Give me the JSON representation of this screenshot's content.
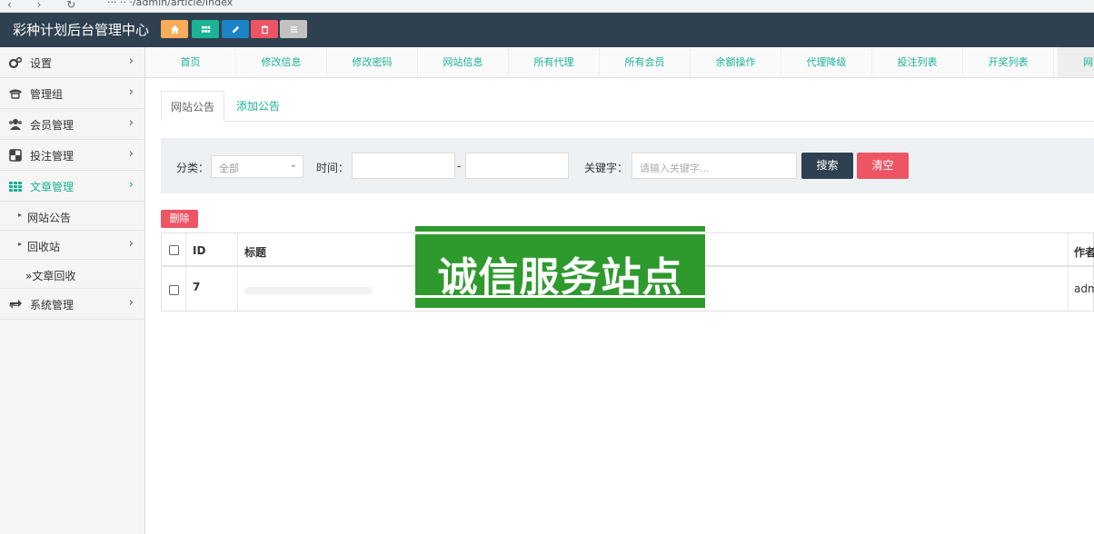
{
  "browser": {
    "nav_glyphs": "‹ › ↻",
    "url": "··· ·· ·/admin/article/index"
  },
  "header": {
    "brand": "彩种计划后台管理中心",
    "quick_buttons": [
      {
        "icon": "home-icon",
        "color": "#f8ac59"
      },
      {
        "icon": "grid-icon",
        "color": "#1ab394"
      },
      {
        "icon": "pencil-icon",
        "color": "#1c84c6"
      },
      {
        "icon": "trash-icon",
        "color": "#ed5565"
      },
      {
        "icon": "list-icon",
        "color": "#c2c2c2"
      }
    ]
  },
  "sidebar": {
    "items": [
      {
        "label": "设置",
        "icon": "gears-icon"
      },
      {
        "label": "管理组",
        "icon": "phone-icon"
      },
      {
        "label": "会员管理",
        "icon": "users-icon"
      },
      {
        "label": "投注管理",
        "icon": "dice-icon"
      },
      {
        "label": "文章管理",
        "icon": "table-grid-icon",
        "active": true
      },
      {
        "label": "系统管理",
        "icon": "refresh-icon"
      }
    ],
    "sub_items": [
      {
        "label": "网站公告"
      },
      {
        "label": "回收站"
      },
      {
        "label": "»文章回收"
      }
    ],
    "chevron": "›",
    "triangle": "▸"
  },
  "tabbar": {
    "tabs": [
      "首页",
      "修改信息",
      "修改密码",
      "网站信息",
      "所有代理",
      "所有会员",
      "余额操作",
      "代理降级",
      "投注列表",
      "开奖列表",
      "网"
    ]
  },
  "subtabs": {
    "active": "网站公告",
    "other": "添加公告"
  },
  "filter": {
    "category_label": "分类：",
    "category_value": "全部",
    "time_label": "时间：",
    "time_separator": "-",
    "start_value": "",
    "end_value": "",
    "keyword_label": "关键字：",
    "keyword_placeholder": "请输入关键字...",
    "search_label": "搜索",
    "clear_label": "清空",
    "search_color": "#2f4050",
    "clear_color": "#ed5565"
  },
  "actions": {
    "delete_label": "删除"
  },
  "table": {
    "columns": [
      "ID",
      "标题",
      "作者"
    ],
    "rows": [
      {
        "id": "7",
        "title": "",
        "author": "adm"
      }
    ]
  },
  "watermark": {
    "text": "诚信服务站点"
  },
  "colors": {
    "accent": "#1ab394",
    "topbar": "#2f4050",
    "danger": "#ed5565"
  }
}
